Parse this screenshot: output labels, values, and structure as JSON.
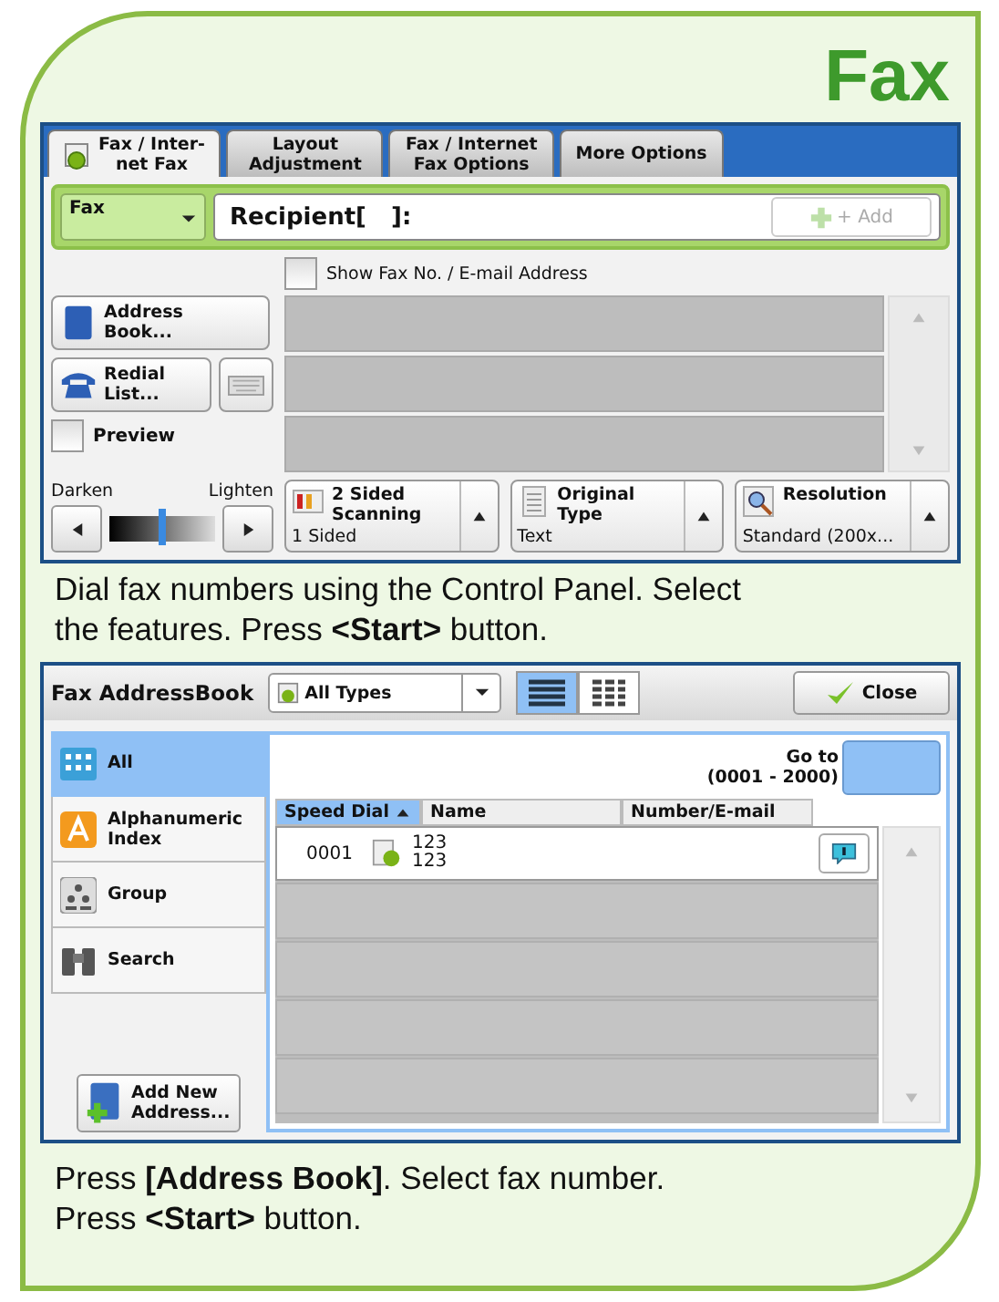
{
  "title": "Fax",
  "fax_screen": {
    "tabs": [
      {
        "label": "Fax / Inter-\nnet Fax",
        "selected": true
      },
      {
        "label": "Layout\nAdjustment",
        "selected": false
      },
      {
        "label": "Fax / Internet\nFax Options",
        "selected": false
      },
      {
        "label": "More Options",
        "selected": false
      }
    ],
    "fax_type": "Fax",
    "recipient_label": "Recipient[   ]:",
    "add_button": {
      "label": "+ Add",
      "disabled": true
    },
    "show_address": {
      "label": "Show Fax No. / E-mail Address",
      "checked": false
    },
    "address_book_button": "Address\nBook...",
    "redial_button": "Redial\nList...",
    "preview": {
      "label": "Preview",
      "checked": false
    },
    "density": {
      "darken": "Darken",
      "lighten": "Lighten",
      "level": 0.5
    },
    "features": [
      {
        "kind": "sided",
        "title": "2 Sided\nScanning",
        "value": "1 Sided"
      },
      {
        "kind": "original",
        "title": "Original Type",
        "value": "Text"
      },
      {
        "kind": "resolution",
        "title": "Resolution",
        "value": "Standard (200x..."
      }
    ]
  },
  "caption_1": [
    "Dial fax numbers using the Control Panel.  Select",
    "the features.  Press **<Start>** button."
  ],
  "address_book": {
    "title": "Fax AddressBook",
    "type_filter": "All Types",
    "views": [
      {
        "kind": "list",
        "selected": true
      },
      {
        "kind": "grid",
        "selected": false
      }
    ],
    "close_button": "Close",
    "sidebar": [
      {
        "kind": "all",
        "label": "All",
        "selected": true
      },
      {
        "kind": "index",
        "label": "Alphanumeric\nIndex",
        "selected": false
      },
      {
        "kind": "group",
        "label": "Group",
        "selected": false
      },
      {
        "kind": "search",
        "label": "Search",
        "selected": false
      }
    ],
    "add_button": "Add New\nAddress...",
    "goto_label": "Go to\n(0001 - 2000)",
    "columns": [
      {
        "label": "Speed Dial",
        "sorted": true
      },
      {
        "label": "Name",
        "sorted": false
      },
      {
        "label": "Number/E-mail",
        "sorted": false
      }
    ],
    "rows": [
      {
        "speed_dial": "0001",
        "name": "123",
        "subtitle": "123"
      }
    ]
  },
  "caption_2": [
    "Press **[Address Book]**.  Select fax number.",
    "Press **<Start>** button."
  ]
}
